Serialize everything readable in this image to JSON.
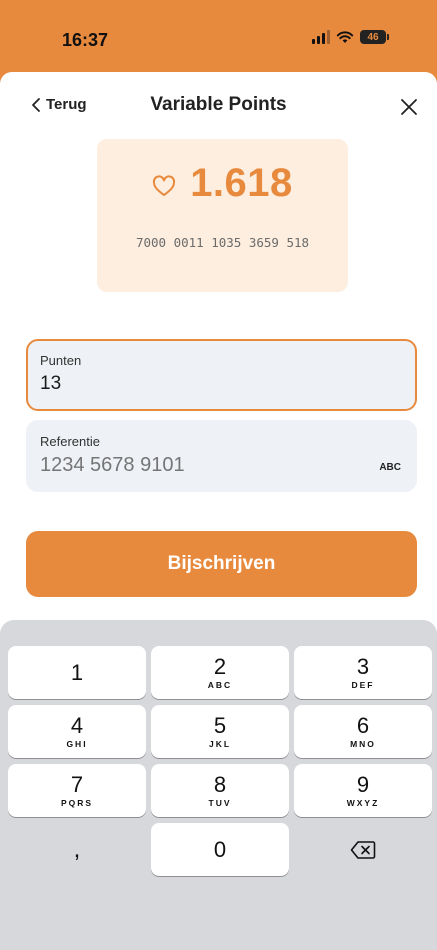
{
  "status_bar": {
    "time": "16:37",
    "battery": "46",
    "icons": [
      "signal-icon",
      "wifi-icon",
      "battery-icon"
    ]
  },
  "nav": {
    "back_label": "Terug",
    "title": "Variable Points",
    "close_icon": "close-icon"
  },
  "points_card": {
    "icon": "heart-icon",
    "points": "1.618",
    "card_number": "7000 0011 1035 3659 518"
  },
  "form": {
    "punten": {
      "label": "Punten",
      "value": "13"
    },
    "referentie": {
      "label": "Referentie",
      "placeholder": "1234 5678 9101",
      "badge": "ABC"
    }
  },
  "submit_label": "Bijschrijven",
  "keyboard": {
    "keys": [
      {
        "digit": "1",
        "letters": ""
      },
      {
        "digit": "2",
        "letters": "ABC"
      },
      {
        "digit": "3",
        "letters": "DEF"
      },
      {
        "digit": "4",
        "letters": "GHI"
      },
      {
        "digit": "5",
        "letters": "JKL"
      },
      {
        "digit": "6",
        "letters": "MNO"
      },
      {
        "digit": "7",
        "letters": "PQRS"
      },
      {
        "digit": "8",
        "letters": "TUV"
      },
      {
        "digit": "9",
        "letters": "WXYZ"
      },
      {
        "digit": "0",
        "letters": ""
      }
    ],
    "comma": ",",
    "delete_icon": "delete-icon"
  },
  "colors": {
    "accent": "#e88a3e",
    "card_bg": "#fdeedf",
    "field_bg": "#eef1f6",
    "keyboard_bg": "#d7d8dc"
  }
}
